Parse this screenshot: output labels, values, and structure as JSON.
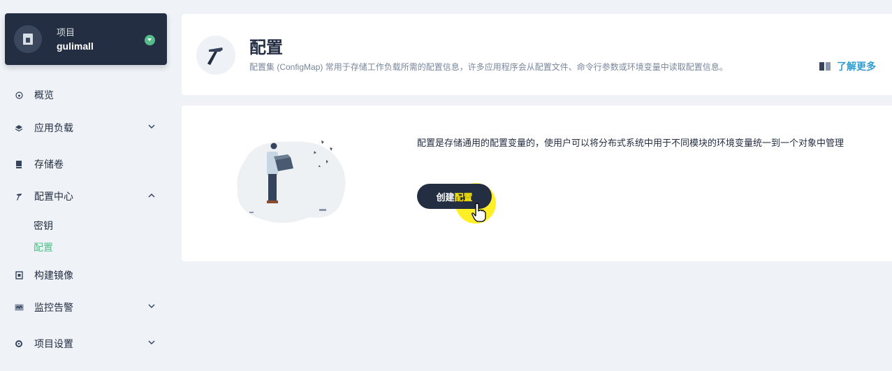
{
  "project": {
    "label": "项目",
    "name": "gulimall"
  },
  "sidebar": {
    "items": [
      {
        "label": "概览",
        "icon": "dashboard-icon"
      },
      {
        "label": "应用负载",
        "icon": "layers-icon",
        "expandable": true,
        "expanded": false
      },
      {
        "label": "存储卷",
        "icon": "storage-icon"
      },
      {
        "label": "配置中心",
        "icon": "hammer-icon",
        "expandable": true,
        "expanded": true,
        "children": [
          {
            "label": "密钥",
            "active": false
          },
          {
            "label": "配置",
            "active": true
          }
        ]
      },
      {
        "label": "构建镜像",
        "icon": "image-build-icon"
      },
      {
        "label": "监控告警",
        "icon": "monitor-icon",
        "expandable": true,
        "expanded": false
      },
      {
        "label": "项目设置",
        "icon": "gear-icon",
        "expandable": true,
        "expanded": false
      }
    ]
  },
  "header": {
    "title": "配置",
    "description": "配置集 (ConfigMap) 常用于存储工作负载所需的配置信息，许多应用程序会从配置文件、命令行参数或环境变量中读取配置信息。",
    "learn_more": "了解更多"
  },
  "empty_state": {
    "text": "配置是存储通用的配置变量的，使用户可以将分布式系统中用于不同模块的环境变量统一到一个对象中管理",
    "button_prefix": "创建",
    "button_highlight": "配置"
  },
  "colors": {
    "sidebar_dark": "#242e42",
    "accent_green": "#55bc8a",
    "link_blue": "#329dce",
    "cursor_highlight": "#ffea00",
    "page_bg": "#eff3f7"
  }
}
